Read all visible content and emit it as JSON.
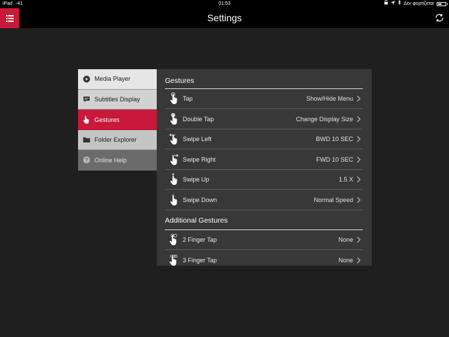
{
  "status_bar": {
    "device": "iPad",
    "signal": "-41",
    "time": "01:53",
    "charging_text": "Δεν φορτίζεται"
  },
  "nav": {
    "title": "Settings",
    "menu_icon": "menu-icon",
    "refresh_icon": "refresh-icon"
  },
  "sidebar": {
    "items": [
      {
        "label": "Media Player",
        "icon": "play-icon"
      },
      {
        "label": "Subtitles Display",
        "icon": "speech-bubble-icon"
      },
      {
        "label": "Gestures",
        "icon": "hand-icon",
        "selected": true
      },
      {
        "label": "Folder Explorer",
        "icon": "folder-icon"
      },
      {
        "label": "Online Help",
        "icon": "help-icon"
      }
    ]
  },
  "gestures": {
    "title": "Gestures",
    "rows": [
      {
        "label": "Tap",
        "value": "Show/Hide Menu"
      },
      {
        "label": "Double Tap",
        "value": "Change Display Size"
      },
      {
        "label": "Swipe Left",
        "value": "BWD 10 SEC"
      },
      {
        "label": "Swipe Right",
        "value": "FWD 10 SEC"
      },
      {
        "label": "Swipe Up",
        "value": "1.5 X"
      },
      {
        "label": "Swipe Down",
        "value": "Normal Speed"
      }
    ]
  },
  "additional": {
    "title": "Additional Gestures",
    "rows": [
      {
        "label": "2 Finger Tap",
        "value": "None"
      },
      {
        "label": "3 Finger Tap",
        "value": "None"
      }
    ]
  },
  "colors": {
    "accent": "#c8193a",
    "background": "#1f1f1f",
    "panel": "#383838"
  }
}
